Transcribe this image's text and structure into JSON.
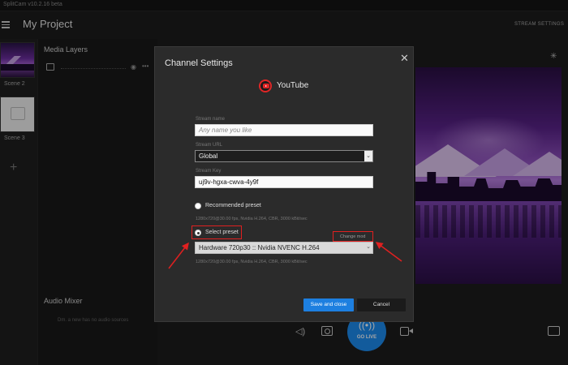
{
  "app": {
    "window_title": "SplitCam v10.2.16 beta"
  },
  "header": {
    "project_title": "My Project",
    "stream_settings_label": "STREAM SETTINGS"
  },
  "scenes": {
    "items": [
      {
        "label": "Scene 2"
      },
      {
        "label": "Scene 3"
      }
    ],
    "add_label": "+"
  },
  "layers": {
    "title": "Media Layers"
  },
  "mixer": {
    "title": "Audio Mixer",
    "empty_text": "Dm. a new has no audio sources"
  },
  "dialog": {
    "title": "Channel Settings",
    "close_glyph": "✕",
    "service_name": "YouTube",
    "stream_name": {
      "label": "Stream name",
      "placeholder": "Any name you like"
    },
    "stream_url": {
      "label": "Stream URL",
      "value": "Global"
    },
    "stream_key": {
      "label": "Stream Key",
      "value": "uj9v-hgxa-cwva-4y9f"
    },
    "recommended_preset": {
      "label": "Recommended preset",
      "desc": "1280x720@30.00 fps, Nvidia H.264, CBR, 3000 kBit/sec"
    },
    "select_preset": {
      "label": "Select preset",
      "selected_value": "Hardware 720p30 :: Nvidia NVENC H.264",
      "desc": "1280x720@30.00 fps, Nvidia H.264, CBR, 3000 kBit/sec",
      "change_link": "Change mod"
    },
    "save_label": "Save and close",
    "cancel_label": "Cancel"
  },
  "controls": {
    "go_live_label": "GO LIVE"
  },
  "colors": {
    "accent": "#1d8cf0",
    "annotation": "#e02020",
    "youtube": "#e02626"
  }
}
